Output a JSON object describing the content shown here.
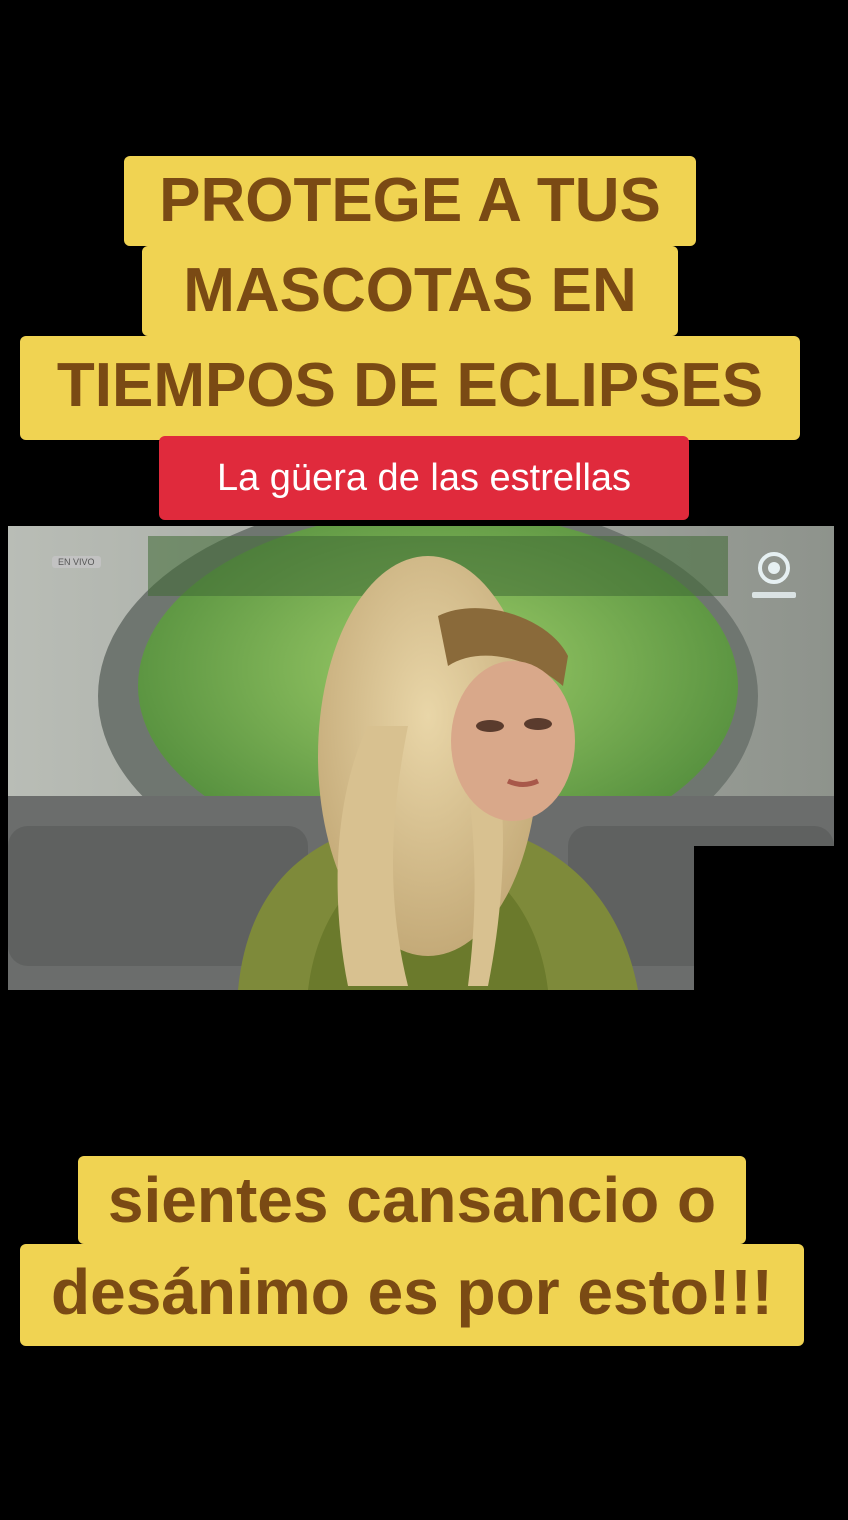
{
  "title_lines": [
    "PROTEGE A TUS",
    "MASCOTAS EN",
    "TIEMPOS DE ECLIPSES"
  ],
  "subtitle": "La güera de las estrellas",
  "bottom_lines": [
    "sientes cansancio o",
    "desánimo es por esto!!!"
  ],
  "video": {
    "live_badge": "EN VIVO",
    "channel_logo": "channel-logo-icon"
  },
  "colors": {
    "caption_bg": "#f0d352",
    "caption_text": "#7a4a14",
    "subtitle_bg": "#e02a3c",
    "subtitle_text": "#ffffff",
    "background": "#000000"
  }
}
